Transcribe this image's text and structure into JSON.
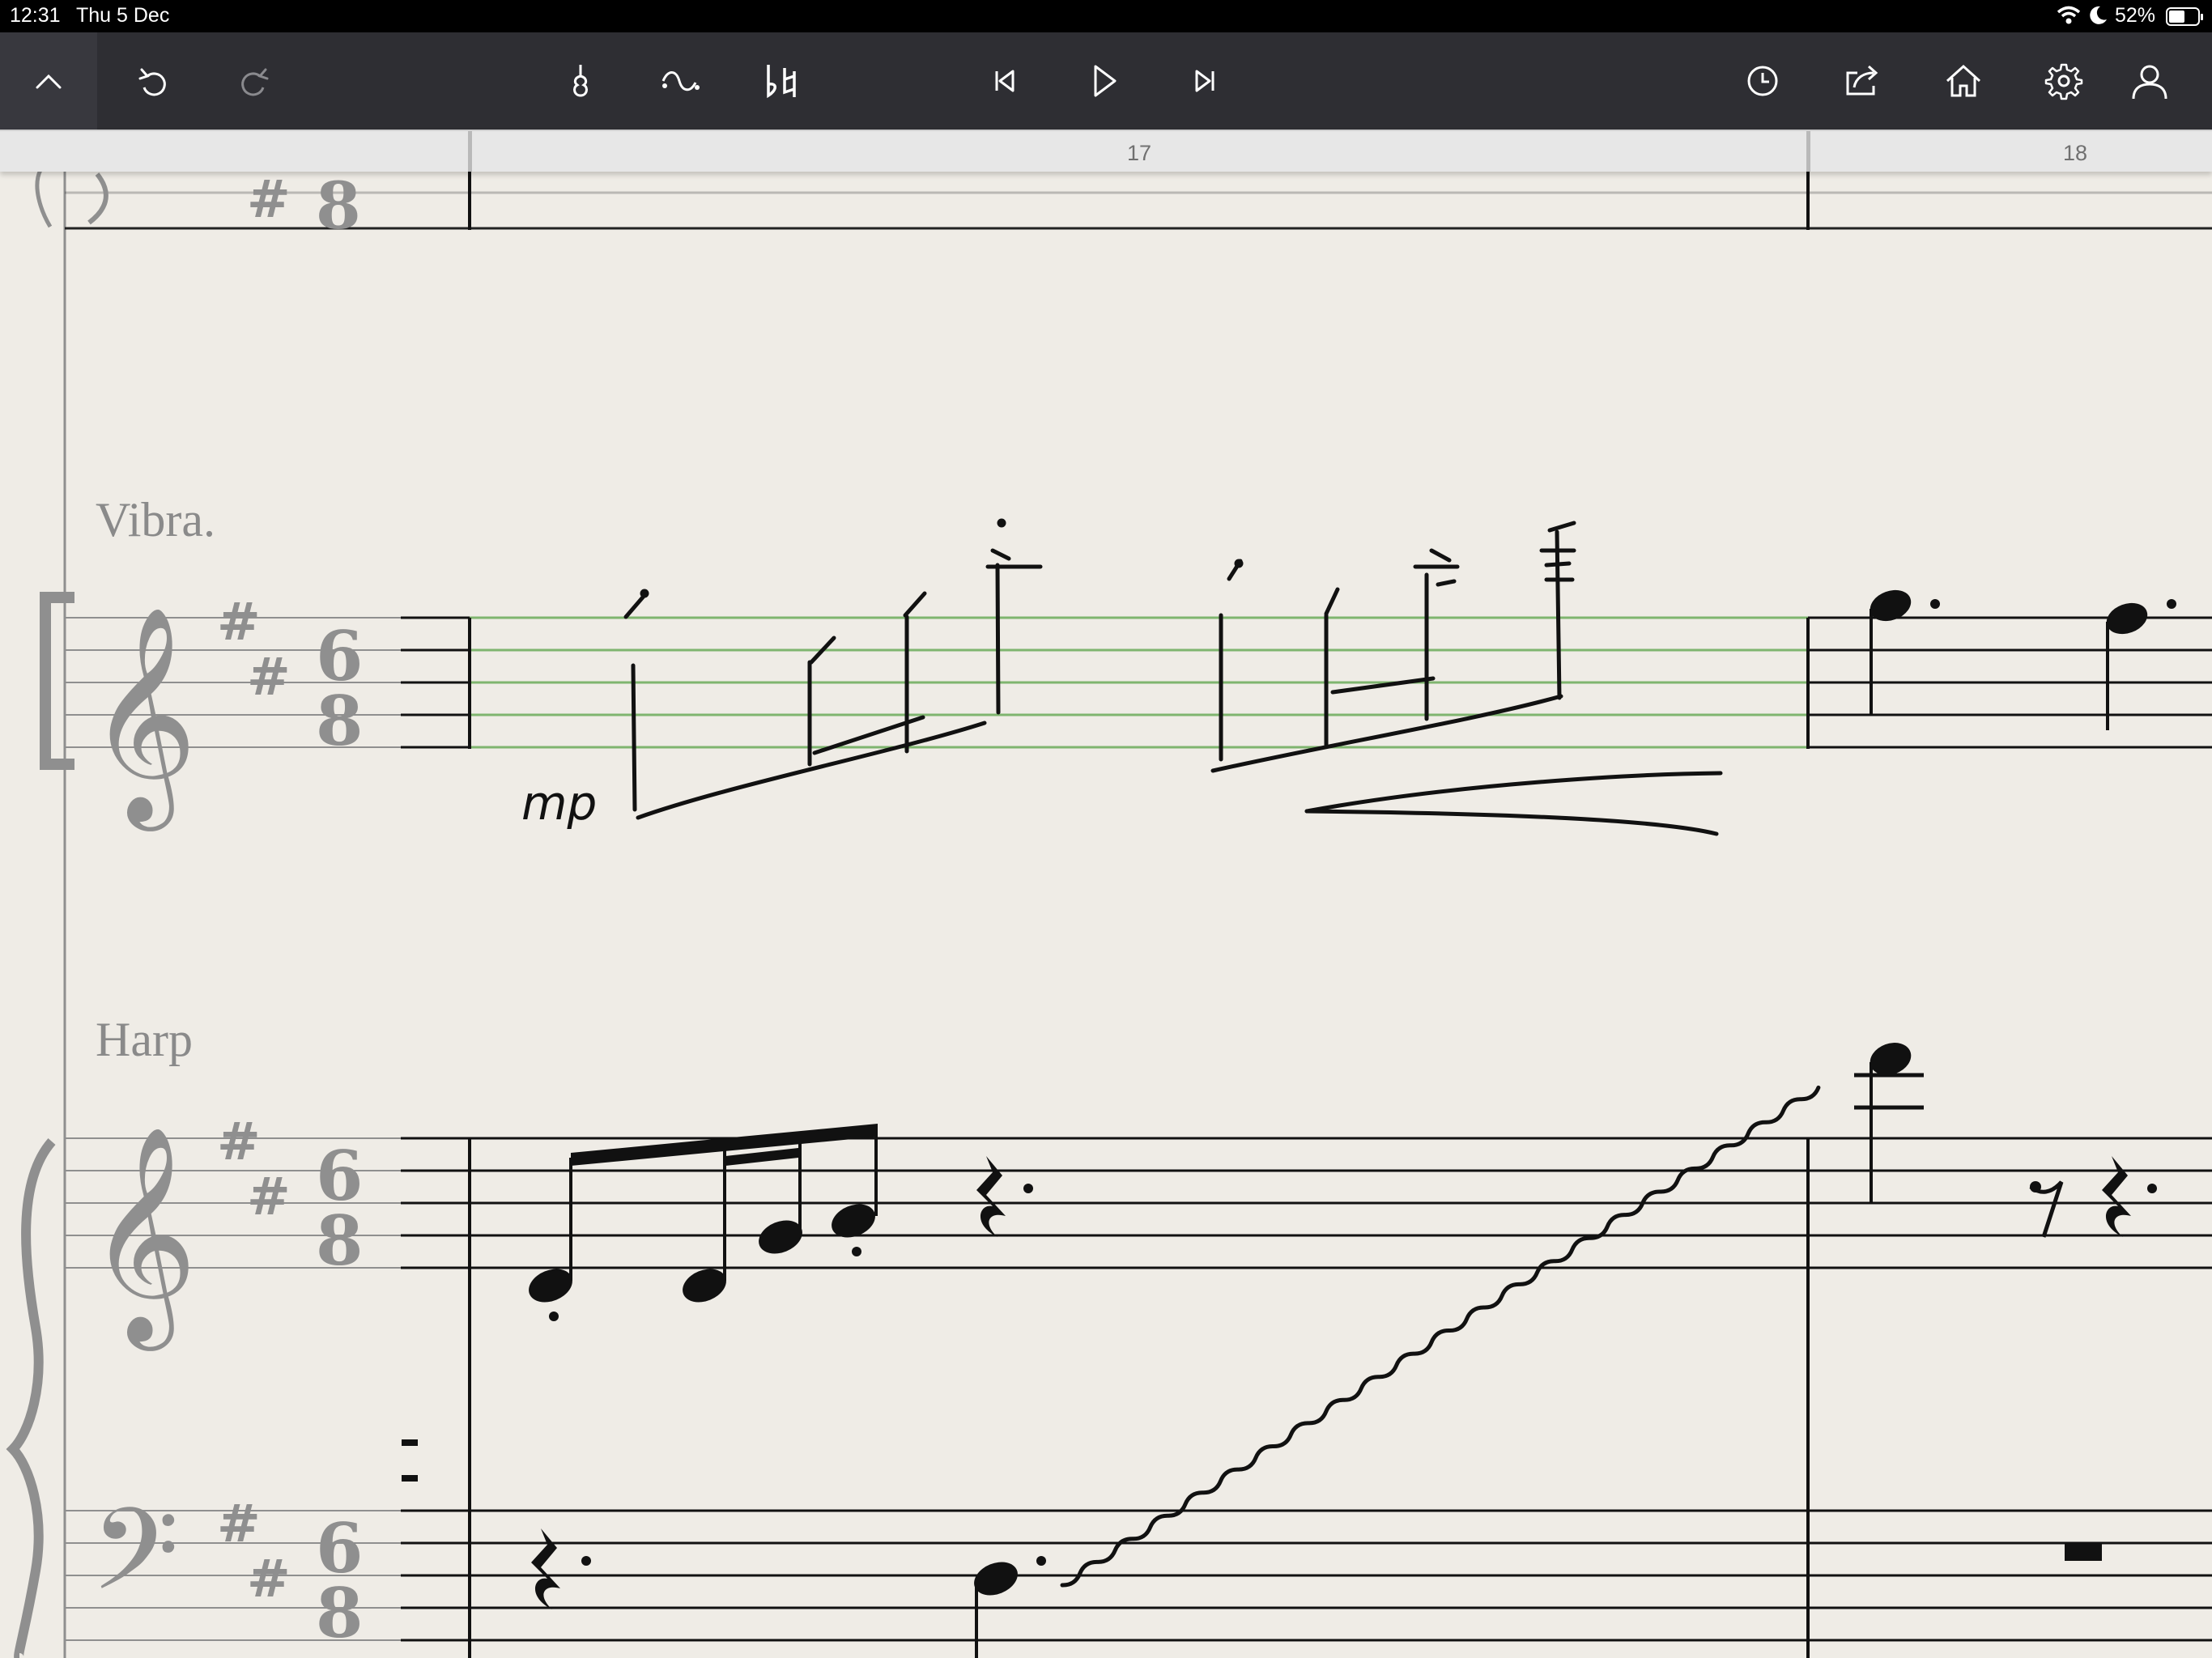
{
  "status_bar": {
    "time": "12:31",
    "date": "Thu 5 Dec",
    "battery": "52%"
  },
  "toolbar": {
    "left": [
      {
        "name": "collapse-button",
        "icon": "chevron-up-icon"
      },
      {
        "name": "undo-button",
        "icon": "undo-icon"
      },
      {
        "name": "redo-button",
        "icon": "redo-icon"
      }
    ],
    "center": [
      {
        "name": "instrument-button",
        "icon": "instrument-icon"
      },
      {
        "name": "articulation-button",
        "icon": "curve-icon"
      },
      {
        "name": "accidentals-button",
        "icon": "flat-natural-icon"
      }
    ],
    "transport": [
      {
        "name": "rewind-button",
        "icon": "skip-back-icon"
      },
      {
        "name": "play-button",
        "icon": "play-icon"
      },
      {
        "name": "forward-button",
        "icon": "skip-forward-icon"
      }
    ],
    "right": [
      {
        "name": "history-button",
        "icon": "clock-icon"
      },
      {
        "name": "share-button",
        "icon": "share-icon"
      },
      {
        "name": "home-button",
        "icon": "home-icon"
      },
      {
        "name": "settings-button",
        "icon": "gear-icon"
      },
      {
        "name": "account-button",
        "icon": "user-icon"
      }
    ]
  },
  "ruler": {
    "measures": [
      "17",
      "18"
    ]
  },
  "score": {
    "staves": [
      {
        "name": "Vibra."
      },
      {
        "name": "Harp"
      }
    ],
    "time_signature": {
      "top": "6",
      "bottom": "8"
    },
    "dynamic": "mp"
  }
}
